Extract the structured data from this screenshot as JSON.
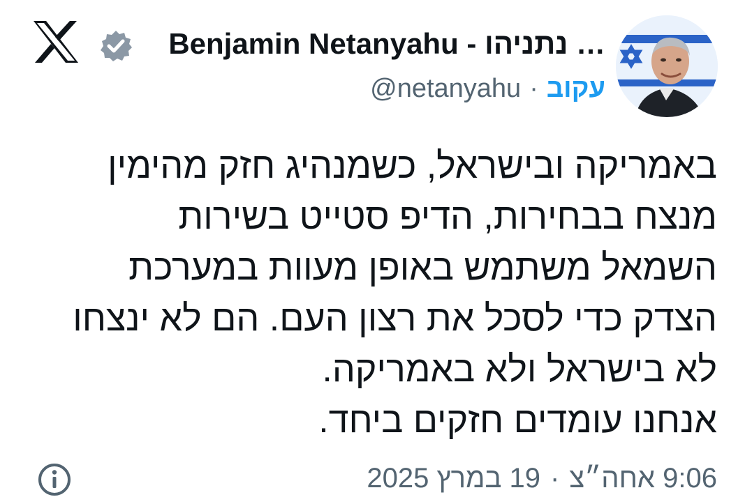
{
  "header": {
    "author_name_he": "נתניהו -",
    "author_name_en": "Benjamin Netanyahu",
    "author_truncation": "…",
    "handle": "@netanyahu",
    "follow_label": "עקוב",
    "separator": "·"
  },
  "tweet": {
    "lines": [
      "באמריקה ובישראל, כשמנהיג חזק מהימין",
      "מנצח בבחירות, הדיפ סטייט בשירות",
      "השמאל משתמש באופן מעוות במערכת",
      "הצדק כדי לסכל את רצון העם. הם לא ינצחו",
      "לא בישראל ולא באמריקה.",
      "אנחנו עומדים חזקים ביחד."
    ]
  },
  "meta": {
    "time": "9:06 אחה״צ",
    "separator": "·",
    "date": "19 במרץ 2025"
  },
  "icons": {
    "logo": "x-logo-icon",
    "verified": "verified-badge-icon",
    "info": "info-icon"
  },
  "colors": {
    "text": "#0f1419",
    "secondary": "#536471",
    "accent": "#1d9bf0",
    "badge": "#8b98a5"
  }
}
